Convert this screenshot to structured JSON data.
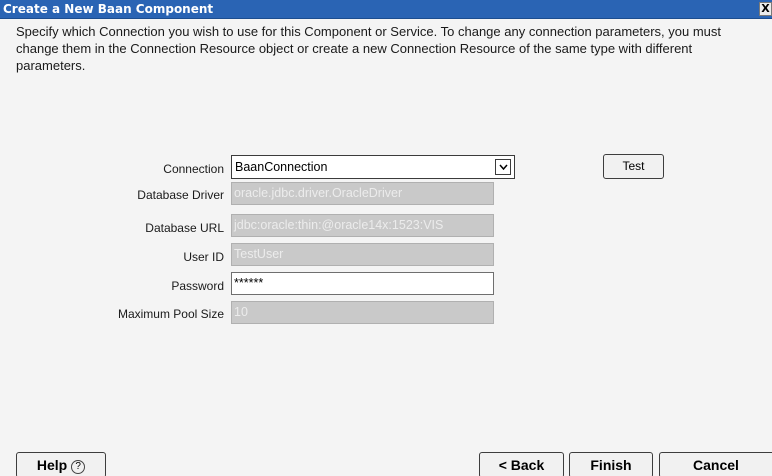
{
  "window": {
    "title": "Create a New Baan Component",
    "close_label": "X"
  },
  "instructions": "Specify which Connection you wish to use for this Component or Service.  To change any connection parameters, you must change them in the Connection Resource object or create a new Connection Resource of the same type with different parameters.",
  "form": {
    "connection": {
      "label": "Connection",
      "value": "BaanConnection",
      "icon": "chevron-down-icon"
    },
    "database_driver": {
      "label": "Database Driver",
      "value": "oracle.jdbc.driver.OracleDriver"
    },
    "database_url": {
      "label": "Database URL",
      "value": "jdbc:oracle:thin:@oracle14x:1523:VIS"
    },
    "user_id": {
      "label": "User ID",
      "value": "TestUser"
    },
    "password": {
      "label": "Password",
      "value": "******"
    },
    "max_pool_size": {
      "label": "Maximum Pool Size",
      "value": "10"
    }
  },
  "buttons": {
    "test": "Test",
    "help": "Help",
    "help_icon": "?",
    "back": "< Back",
    "finish": "Finish",
    "cancel": "Cancel"
  },
  "colors": {
    "titlebar": "#2a64b4",
    "background": "#f4f4f4",
    "disabled_field": "#c9c9c9"
  }
}
